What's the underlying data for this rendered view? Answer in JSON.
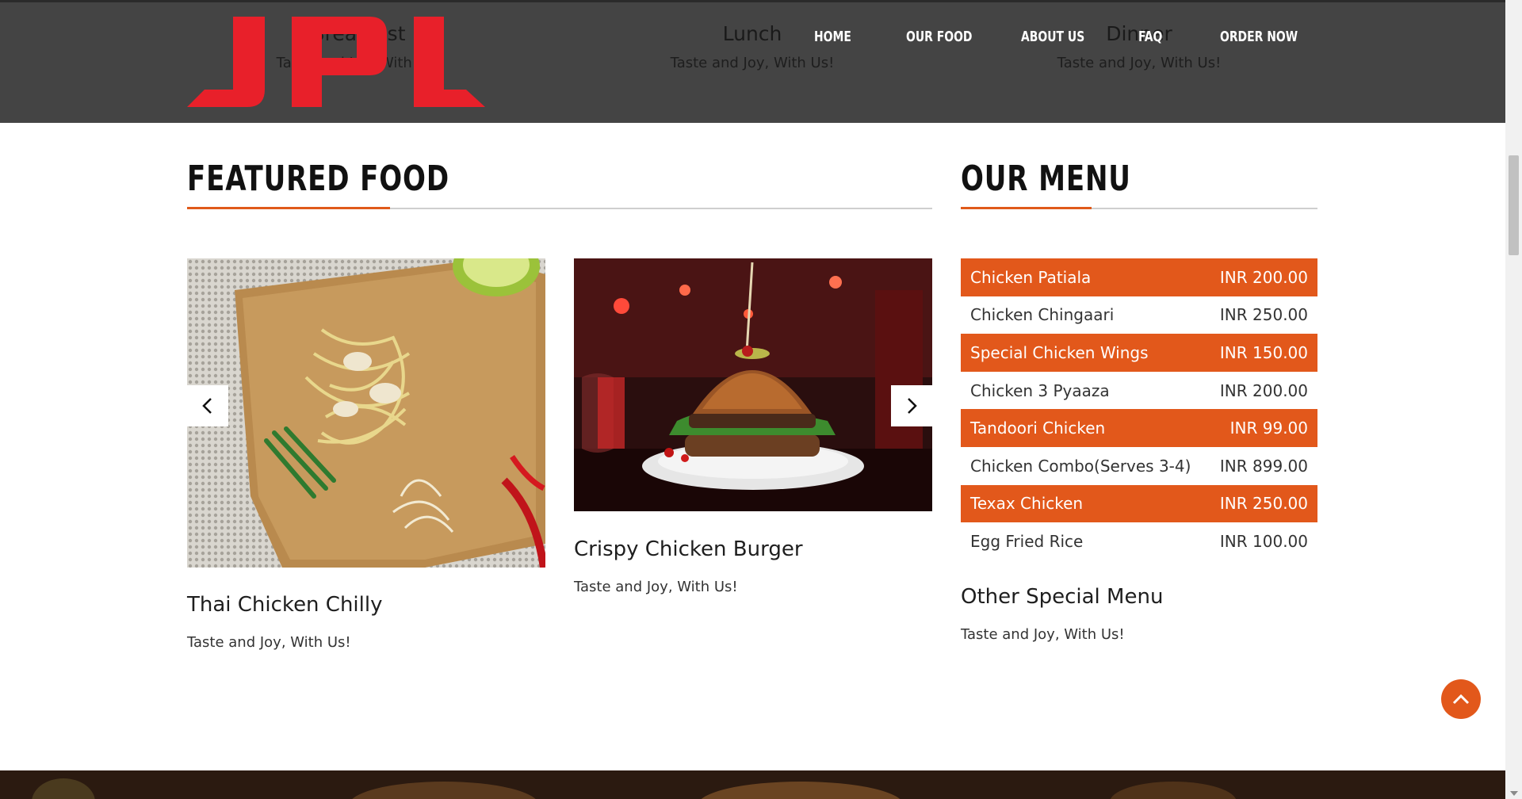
{
  "header": {
    "behind_items": [
      {
        "title": "Breakfast",
        "subtitle": "Taste and Joy, With Us!"
      },
      {
        "title": "Lunch",
        "subtitle": "Taste and Joy, With Us!"
      },
      {
        "title": "Dinner",
        "subtitle": "Taste and Joy, With Us!"
      }
    ],
    "logo_text": "JPL",
    "nav": [
      "HOME",
      "OUR FOOD",
      "ABOUT US",
      "FAQ",
      "ORDER NOW"
    ]
  },
  "featured": {
    "heading": "FEATURED FOOD",
    "items": [
      {
        "title": "Thai Chicken Chilly",
        "subtitle": "Taste and Joy, With Us!"
      },
      {
        "title": "Crispy Chicken Burger",
        "subtitle": "Taste and Joy, With Us!"
      }
    ]
  },
  "menu": {
    "heading": "OUR MENU",
    "items": [
      {
        "name": "Chicken Patiala",
        "price": "INR 200.00"
      },
      {
        "name": "Chicken Chingaari",
        "price": "INR 250.00"
      },
      {
        "name": "Special Chicken Wings",
        "price": "INR 150.00"
      },
      {
        "name": "Chicken 3 Pyaaza",
        "price": "INR 200.00"
      },
      {
        "name": "Tandoori Chicken",
        "price": "INR 99.00"
      },
      {
        "name": "Chicken Combo(Serves 3-4)",
        "price": "INR 899.00"
      },
      {
        "name": "Texax Chicken",
        "price": "INR 250.00"
      },
      {
        "name": "Egg Fried Rice",
        "price": "INR 100.00"
      }
    ],
    "other_title": "Other Special Menu",
    "other_subtitle": "Taste and Joy, With Us!"
  },
  "colors": {
    "accent": "#e2581b",
    "header_bg": "#444444",
    "logo_red": "#e8202a"
  },
  "icons": {
    "prev": "chevron-left-icon",
    "next": "chevron-right-icon",
    "top": "chevron-up-icon"
  }
}
